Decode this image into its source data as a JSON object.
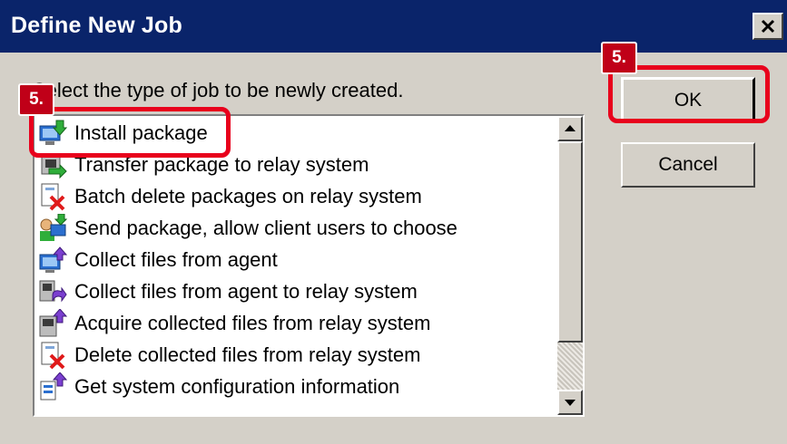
{
  "window": {
    "title": "Define New Job"
  },
  "dialog": {
    "prompt": "Select the type of job to be newly created.",
    "ok_label": "OK",
    "cancel_label": "Cancel"
  },
  "job_types": [
    {
      "label": "Install package",
      "icon": "install-package-icon"
    },
    {
      "label": "Transfer package to relay system",
      "icon": "transfer-package-icon"
    },
    {
      "label": "Batch delete packages on relay system",
      "icon": "batch-delete-icon"
    },
    {
      "label": "Send package, allow client users to choose",
      "icon": "send-package-icon"
    },
    {
      "label": "Collect files from agent",
      "icon": "collect-files-icon"
    },
    {
      "label": "Collect files from agent to relay system",
      "icon": "collect-to-relay-icon"
    },
    {
      "label": "Acquire collected files from relay system",
      "icon": "acquire-files-icon"
    },
    {
      "label": "Delete collected files from relay system",
      "icon": "delete-collected-icon"
    },
    {
      "label": "Get system configuration information",
      "icon": "system-config-icon"
    }
  ],
  "annotations": {
    "step_label": "5."
  },
  "colors": {
    "title_bar": "#0a246a",
    "highlight": "#e8001c",
    "dialog_bg": "#d4d0c8"
  }
}
